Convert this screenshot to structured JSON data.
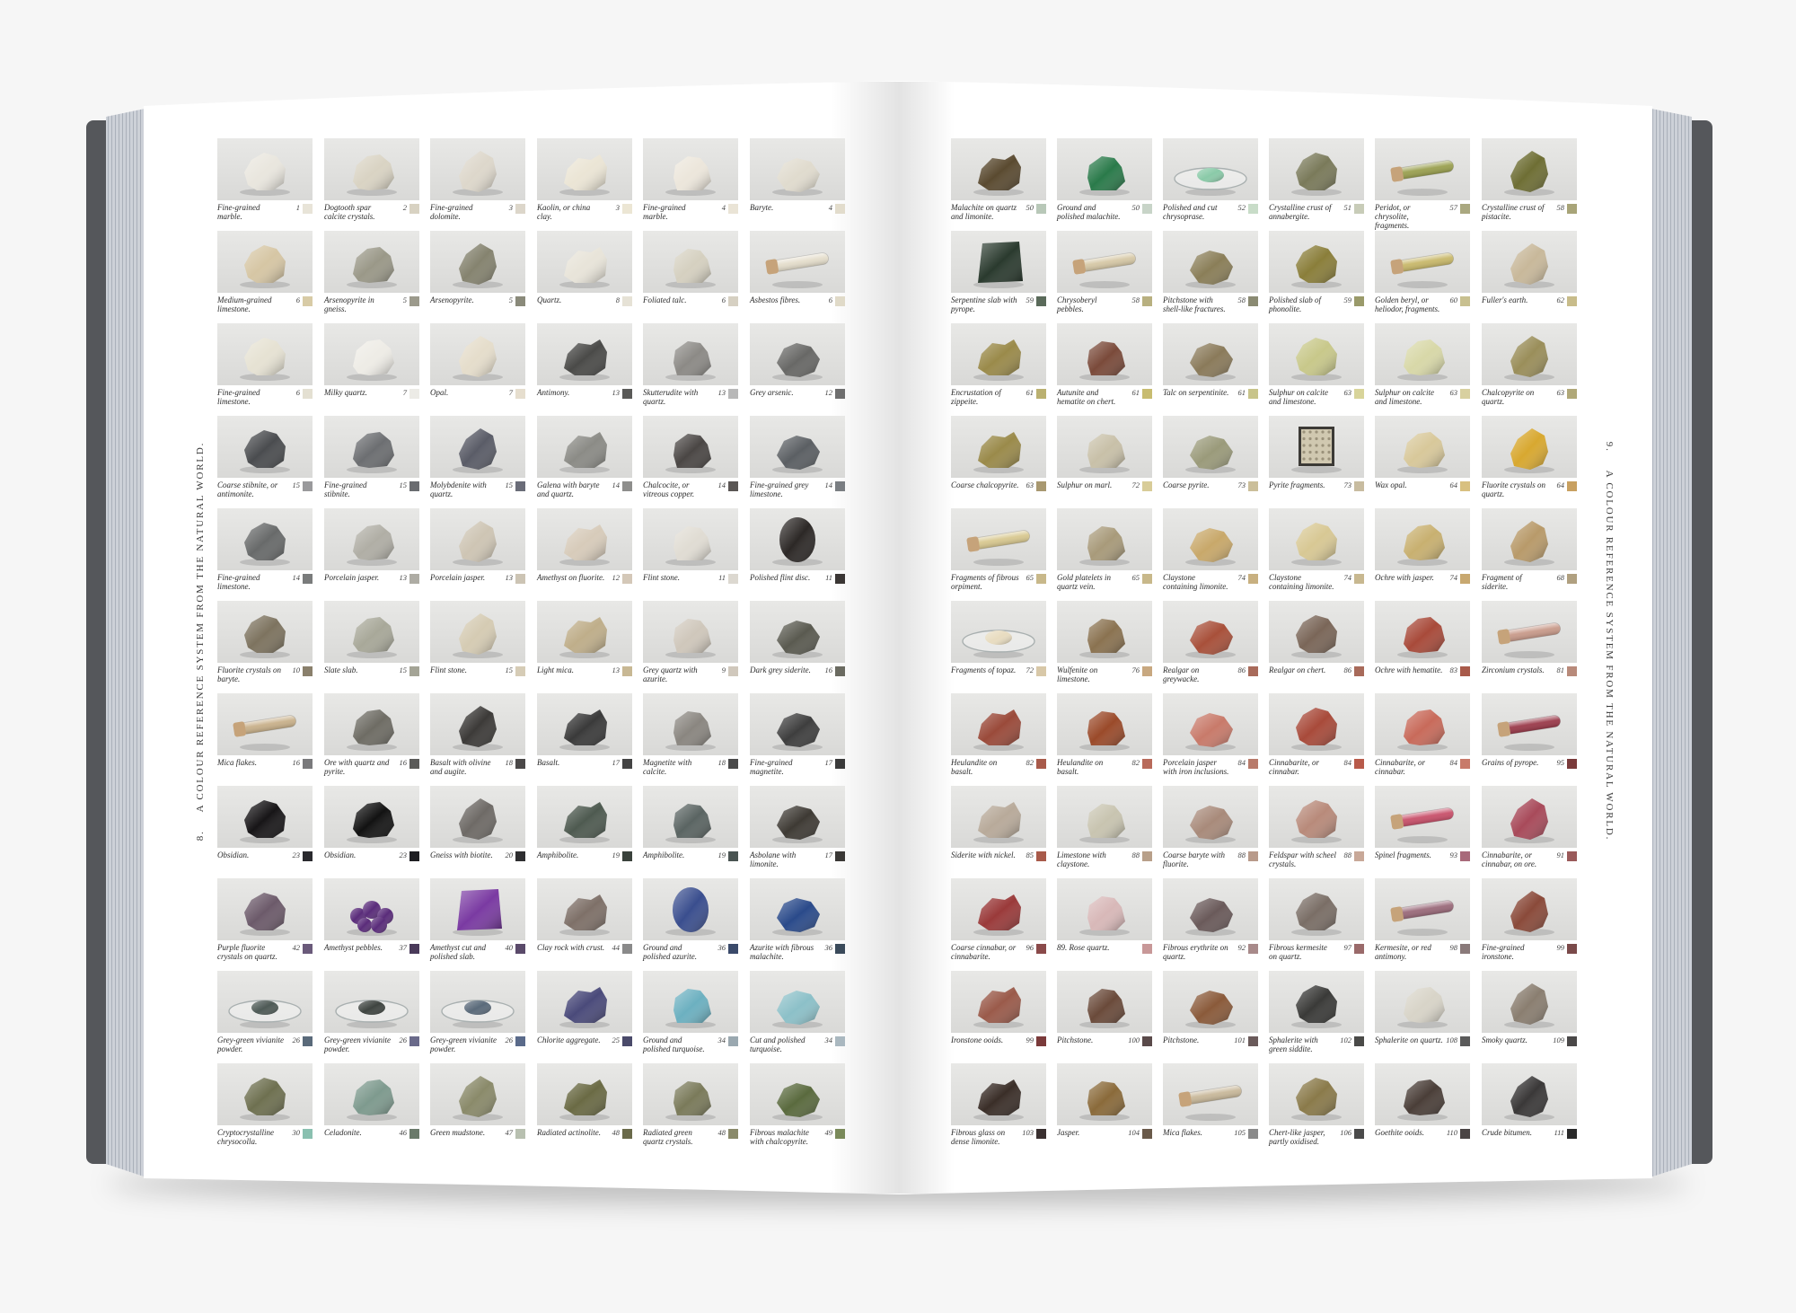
{
  "running_heads": {
    "left_number": "8.",
    "left_title": "A COLOUR REFERENCE SYSTEM FROM THE NATURAL WORLD.",
    "right_number": "9.",
    "right_title": "A COLOUR REFERENCE SYSTEM FROM THE NATURAL WORLD."
  },
  "colors": {
    "cover": "#55575b",
    "page": "#ffffff",
    "page_edges": "#cdd1d8",
    "photo_bg": "#dedede"
  },
  "left_page": {
    "rows": [
      [
        [
          "Fine-grained marble.",
          "1",
          "#e9e6de",
          "#e8e4d8"
        ],
        [
          "Dogtooth spar calcite crystals.",
          "2",
          "#d9d3c3",
          "#d8d2c2"
        ],
        [
          "Fine-grained dolomite.",
          "3",
          "#ddd7cb",
          "#dcd6ca"
        ],
        [
          "Kaolin, or china clay.",
          "3",
          "#ebe5d5",
          "#ece6d4"
        ],
        [
          "Fine-grained marble.",
          "4",
          "#ece6db",
          "#eae4d6"
        ],
        [
          "Baryte.",
          "4",
          "#e0dbce",
          "#e2dccc"
        ]
      ],
      [
        [
          "Medium-grained limestone.",
          "6",
          "#d6c6a4",
          "#d8cba6"
        ],
        [
          "Arsenopyrite in gneiss.",
          "5",
          "#9a9888",
          "#9c9a8c"
        ],
        [
          "Arsenopyrite.",
          "5",
          "#85836f",
          "#8a8a7a"
        ],
        [
          "Quartz.",
          "8",
          "#e8e4d9",
          "#e6e2d6"
        ],
        [
          "Foliated talc.",
          "6",
          "#d5d0c0",
          "#d6d0c2"
        ],
        [
          "Asbestos fibres.",
          "6",
          "#e4ddcb",
          "#e0dac8",
          "tube"
        ]
      ],
      [
        [
          "Fine-grained limestone.",
          "6",
          "#e6e2d3",
          "#e4e0d2"
        ],
        [
          "Milky quartz.",
          "7",
          "#eeece6",
          "#ecebe6"
        ],
        [
          "Opal.",
          "7",
          "#e5ddcb",
          "#e6dece"
        ],
        [
          "Antimony.",
          "13",
          "#4a4a48",
          "#5a5a58"
        ],
        [
          "Skutterudite with quartz.",
          "13",
          "#8c8a86",
          "#b8b8b8"
        ],
        [
          "Grey arsenic.",
          "12",
          "#686866",
          "#6e6e6e"
        ]
      ],
      [
        [
          "Coarse stibnite, or antimonite.",
          "15",
          "#4a4c4f",
          "#9a9a9c"
        ],
        [
          "Fine-grained stibnite.",
          "15",
          "#6c6e71",
          "#6a6c70"
        ],
        [
          "Molybdenite with quartz.",
          "15",
          "#5a5c67",
          "#6a6c78"
        ],
        [
          "Galena with baryte and quartz.",
          "14",
          "#8b8b86",
          "#8e8e8c"
        ],
        [
          "Chalcocite, or vitreous copper.",
          "14",
          "#4a4644",
          "#5a5654"
        ],
        [
          "Fine-grained grey limestone.",
          "14",
          "#5b5f63",
          "#7a7e82"
        ]
      ],
      [
        [
          "Fine-grained limestone.",
          "14",
          "#686a6a",
          "#7a7c7c"
        ],
        [
          "Porcelain jasper.",
          "13",
          "#b0aea5",
          "#aeaca4"
        ],
        [
          "Porcelain jasper.",
          "13",
          "#cec5b4",
          "#ccc4b4"
        ],
        [
          "Amethyst on fluorite.",
          "12",
          "#d7cbba",
          "#d4c8b8"
        ],
        [
          "Flint stone.",
          "11",
          "#e0dcd3",
          "#dcd8d0"
        ],
        [
          "Polished flint disc.",
          "11",
          "#2c2826",
          "#3a3634",
          "disc"
        ]
      ],
      [
        [
          "Fluorite crystals on baryte.",
          "10",
          "#7d735f",
          "#8a806c"
        ],
        [
          "Slate slab.",
          "15",
          "#a8a899",
          "#a4a496"
        ],
        [
          "Flint stone.",
          "15",
          "#d5cbb3",
          "#d6ccb6"
        ],
        [
          "Light mica.",
          "13",
          "#bfae8a",
          "#c8b894"
        ],
        [
          "Grey quartz with azurite.",
          "9",
          "#cfc7bb",
          "#d0c8bc"
        ],
        [
          "Dark grey siderite.",
          "16",
          "#5a5a50",
          "#6a6a60"
        ]
      ],
      [
        [
          "Mica flakes.",
          "16",
          "#c8b08a",
          "#7a7a7c",
          "tube"
        ],
        [
          "Ore with quartz and pyrite.",
          "16",
          "#6e6c64",
          "#5a5a58"
        ],
        [
          "Basalt with olivine and augite.",
          "18",
          "#3c3a38",
          "#4a4848"
        ],
        [
          "Basalt.",
          "17",
          "#3a3a3a",
          "#444444"
        ],
        [
          "Magnetite with calcite.",
          "18",
          "#8a8680",
          "#4a4a4a"
        ],
        [
          "Fine-grained magnetite.",
          "17",
          "#3e3e3e",
          "#3a3a3a"
        ]
      ],
      [
        [
          "Obsidian.",
          "23",
          "#171517",
          "#2a2a2e"
        ],
        [
          "Obsidian.",
          "23",
          "#121212",
          "#1e1e22"
        ],
        [
          "Gneiss with biotite.",
          "20",
          "#6e6a66",
          "#2e2e30"
        ],
        [
          "Amphibolite.",
          "19",
          "#4e5a50",
          "#3a423c"
        ],
        [
          "Amphibolite.",
          "19",
          "#5a6462",
          "#4a5452"
        ],
        [
          "Asbolane with limonite.",
          "17",
          "#3e3a34",
          "#3a3836"
        ]
      ],
      [
        [
          "Purple fluorite crystals on quartz.",
          "42",
          "#6c5a6a",
          "#6a5a7a"
        ],
        [
          "Amethyst pebbles.",
          "37",
          "#5a2c7a",
          "#4a3a5a",
          "pebbles"
        ],
        [
          "Amethyst cut and polished slab.",
          "40",
          "#7a3aa2",
          "#5a4a6a",
          "slab"
        ],
        [
          "Clay rock with crust.",
          "44",
          "#7e7068",
          "#8a8a8a"
        ],
        [
          "Ground and polished azurite.",
          "36",
          "#3a4e8e",
          "#3a4a6a",
          "disc"
        ],
        [
          "Azurite with fibrous malachite.",
          "36",
          "#2a4a8a",
          "#3a4a5a"
        ]
      ],
      [
        [
          "Grey-green vivianite powder.",
          "26",
          "#4e5a56",
          "#5a6a7a",
          "dish"
        ],
        [
          "Grey-green vivianite powder.",
          "26",
          "#3e4440",
          "#6a6a8a",
          "dish"
        ],
        [
          "Grey-green vivianite powder.",
          "26",
          "#5a6a7a",
          "#5a6a8a",
          "dish"
        ],
        [
          "Chlorite aggregate.",
          "25",
          "#4a4a7a",
          "#4a4a6a"
        ],
        [
          "Ground and polished turquoise.",
          "34",
          "#6cb0c0",
          "#9aa8b0"
        ],
        [
          "Cut and polished turquoise.",
          "34",
          "#8cc0c8",
          "#aab8c0"
        ]
      ],
      [
        [
          "Cryptocrystalline chrysocolla.",
          "30",
          "#6e7050",
          "#8ac0b0"
        ],
        [
          "Celadonite.",
          "46",
          "#7e9a8e",
          "#6a7a6a"
        ],
        [
          "Green mudstone.",
          "47",
          "#8a8a6a",
          "#b8c0b0"
        ],
        [
          "Radiated actinolite.",
          "48",
          "#6a6a44",
          "#6a6a4a"
        ],
        [
          "Radiated green quartz crystals.",
          "48",
          "#7a7a5a",
          "#8a8a6a"
        ],
        [
          "Fibrous malachite with chalcopyrite.",
          "49",
          "#5a6a3e",
          "#7a8a5a"
        ]
      ]
    ]
  },
  "right_page": {
    "rows": [
      [
        [
          "Malachite on quartz and limonite.",
          "50",
          "#5a4a30",
          "#b8c8b8"
        ],
        [
          "Ground and polished malachite.",
          "50",
          "#2a7a4a",
          "#c8d4c8"
        ],
        [
          "Polished and cut chrysoprase.",
          "52",
          "#8acaa8",
          "#c8dcc8",
          "dish"
        ],
        [
          "Crystalline crust of annabergite.",
          "51",
          "#7a7a5a",
          "#c8ccb8"
        ],
        [
          "Peridot, or chrysolite, fragments.",
          "57",
          "#9aa050",
          "#aaa880",
          "tube"
        ],
        [
          "Crystalline crust of pistacite.",
          "58",
          "#6e6e34",
          "#a8a478"
        ]
      ],
      [
        [
          "Serpentine slab with pyrope.",
          "59",
          "#2a3a2e",
          "#5a6a5a",
          "slab"
        ],
        [
          "Chrysoberyl pebbles.",
          "58",
          "#d6c8a6",
          "#b8b080",
          "tube"
        ],
        [
          "Pitchstone with shell-like fractures.",
          "58",
          "#8a7e58",
          "#8a8a72"
        ],
        [
          "Polished slab of phonolite.",
          "59",
          "#8a7e3a",
          "#9a9a6a"
        ],
        [
          "Golden beryl, or heliodor, fragments.",
          "60",
          "#c8b86a",
          "#c8c090",
          "tube"
        ],
        [
          "Fuller's earth.",
          "62",
          "#c8b89a",
          "#c8bc8a"
        ]
      ],
      [
        [
          "Encrustation of zippeite.",
          "61",
          "#9a8a4a",
          "#bab070"
        ],
        [
          "Autunite and hematite on chert.",
          "61",
          "#7a4a3a",
          "#c8bc70"
        ],
        [
          "Talc on serpentinite.",
          "61",
          "#8a7a5a",
          "#c8c48a"
        ],
        [
          "Sulphur on calcite and limestone.",
          "63",
          "#c8c88a",
          "#d8d49a"
        ],
        [
          "Sulphur on calcite and limestone.",
          "63",
          "#d8d8a8",
          "#d8d0a0"
        ],
        [
          "Chalcopyrite on quartz.",
          "63",
          "#9a8e5a",
          "#b0a878"
        ]
      ],
      [
        [
          "Coarse chalcopyrite.",
          "63",
          "#9a8a4a",
          "#a89870"
        ],
        [
          "Sulphur on marl.",
          "72",
          "#c8c0a8",
          "#d8cc98"
        ],
        [
          "Coarse pyrite.",
          "73",
          "#9a9a7a",
          "#cbbf9a"
        ],
        [
          "Pyrite fragments.",
          "73",
          "#d0c8b0",
          "#c8bca0",
          "box"
        ],
        [
          "Wax opal.",
          "64",
          "#d8c89a",
          "#d8c080"
        ],
        [
          "Fluorite crystals on quartz.",
          "64",
          "#d8a830",
          "#c8a060"
        ]
      ],
      [
        [
          "Fragments of fibrous orpiment.",
          "65",
          "#d8c890",
          "#c8b88a",
          "tube"
        ],
        [
          "Gold platelets in quartz vein.",
          "65",
          "#a89a7a",
          "#c8b88a"
        ],
        [
          "Claystone containing limonite.",
          "74",
          "#c8a86a",
          "#c8b080"
        ],
        [
          "Claystone containing limonite.",
          "74",
          "#d8c894",
          "#c8b890"
        ],
        [
          "Ochre with jasper.",
          "74",
          "#c8b070",
          "#c8a870"
        ],
        [
          "Fragment of siderite.",
          "68",
          "#b89a6a",
          "#b0a080"
        ]
      ],
      [
        [
          "Fragments of topaz.",
          "72",
          "#e8dcc0",
          "#d8c8a8",
          "dish"
        ],
        [
          "Wulfenite on limestone.",
          "76",
          "#8a7250",
          "#c8a880"
        ],
        [
          "Realgar on greywacke.",
          "86",
          "#a8503a",
          "#a86a5a"
        ],
        [
          "Realgar on chert.",
          "86",
          "#7a6658",
          "#a86a5a"
        ],
        [
          "Ochre with hematite.",
          "83",
          "#a84a3a",
          "#a85a4a"
        ],
        [
          "Zirconium crystals.",
          "81",
          "#c89a8a",
          "#b88a7a",
          "tube"
        ]
      ],
      [
        [
          "Heulandite on basalt.",
          "82",
          "#9a4a3a",
          "#a85a4a"
        ],
        [
          "Heulandite on basalt.",
          "82",
          "#9a4a2a",
          "#b86a5a"
        ],
        [
          "Porcelain jasper with iron inclusions.",
          "84",
          "#c87a6a",
          "#b87a6a"
        ],
        [
          "Cinnabarite, or cinnabar.",
          "84",
          "#a84a3a",
          "#b85a4a"
        ],
        [
          "Cinnabarite, or cinnabar.",
          "84",
          "#c86a5a",
          "#c87a6a"
        ],
        [
          "Grains of pyrope.",
          "95",
          "#9a3a4a",
          "#7a3a3a",
          "tube"
        ]
      ],
      [
        [
          "Siderite with nickel.",
          "85",
          "#b8aa9a",
          "#a85a4a"
        ],
        [
          "Limestone with claystone.",
          "88",
          "#c8c4b0",
          "#b8a08a"
        ],
        [
          "Coarse baryte with fluorite.",
          "88",
          "#a88a7a",
          "#b89a8a"
        ],
        [
          "Feldspar with scheel crystals.",
          "88",
          "#b88a7a",
          "#c8a898"
        ],
        [
          "Spinel fragments.",
          "93",
          "#c8506a",
          "#a86a7a",
          "tube"
        ],
        [
          "Cinnabarite, or cinnabar, on ore.",
          "91",
          "#a84a5a",
          "#9a5a5a"
        ]
      ],
      [
        [
          "Coarse cinnabar, or cinnabarite.",
          "96",
          "#9a3a3a",
          "#8a4a4a"
        ],
        [
          "89. Rose quartz.",
          "",
          "#d8b8b8",
          "#c89898"
        ],
        [
          "Fibrous erythrite on quartz.",
          "92",
          "#6a5a5a",
          "#a88a8a"
        ],
        [
          "Fibrous kermesite on quartz.",
          "97",
          "#7a6e66",
          "#9a6a6a"
        ],
        [
          "Kermesite, or red antimony.",
          "98",
          "#9a6a7a",
          "#8a7a7a",
          "tube"
        ],
        [
          "Fine-grained ironstone.",
          "99",
          "#8a4a3a",
          "#7a4a4a"
        ]
      ],
      [
        [
          "Ironstone ooids.",
          "99",
          "#9a5a4a",
          "#7a3a3a"
        ],
        [
          "Pitchstone.",
          "100",
          "#6a4a3a",
          "#5a4a4a"
        ],
        [
          "Pitchstone.",
          "101",
          "#8a5a3a",
          "#6a5a5a"
        ],
        [
          "Sphalerite with green siddite.",
          "102",
          "#3a3a38",
          "#4a4a48"
        ],
        [
          "Sphalerite on quartz.",
          "108",
          "#d8d4c8",
          "#5a5a5a"
        ],
        [
          "Smoky quartz.",
          "109",
          "#8a7e70",
          "#4a4848"
        ]
      ],
      [
        [
          "Fibrous glass on dense limonite.",
          "103",
          "#3a2e28",
          "#3a3030"
        ],
        [
          "Jasper.",
          "104",
          "#8a6a3a",
          "#6a5a4a"
        ],
        [
          "Mica flakes.",
          "105",
          "#c8b89a",
          "#8a8a8a",
          "tube"
        ],
        [
          "Chert-like jasper, partly oxidised.",
          "106",
          "#8a7a4a",
          "#4a4a4a"
        ],
        [
          "Goethite ooids.",
          "110",
          "#4a3e38",
          "#4a4444"
        ],
        [
          "Crude bitumen.",
          "111",
          "#3a3838",
          "#2a2a2a"
        ]
      ]
    ]
  }
}
